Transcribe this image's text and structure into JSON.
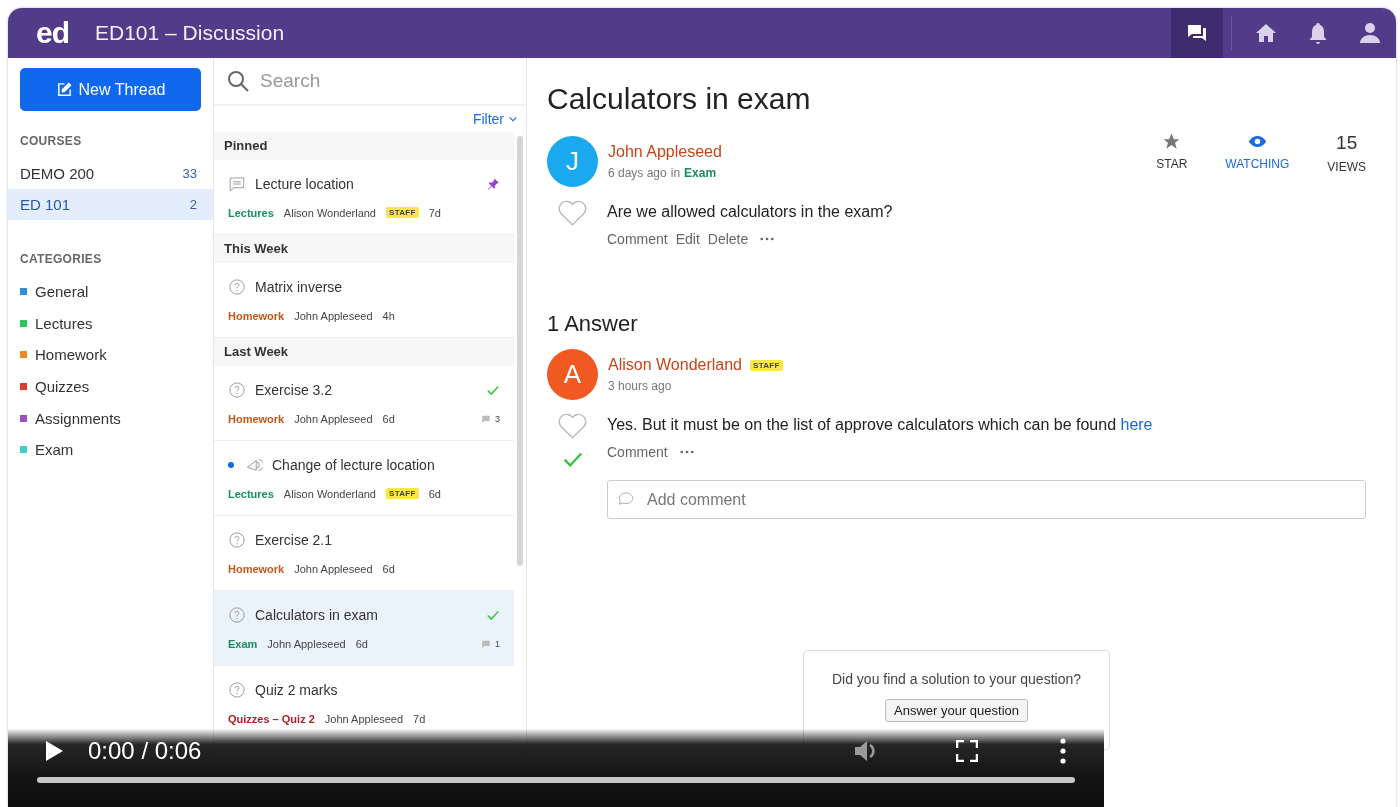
{
  "header": {
    "logo": "ed",
    "title": "ED101 – Discussion",
    "nav": [
      {
        "kind": "chat",
        "selected": true
      },
      {
        "kind": "home",
        "selected": false
      },
      {
        "kind": "bell",
        "selected": false
      },
      {
        "kind": "user",
        "selected": false
      }
    ]
  },
  "sidebar": {
    "new_thread_button": "New Thread",
    "courses_heading": "COURSES",
    "courses": [
      {
        "name": "DEMO 200",
        "count": "33",
        "selected": false
      },
      {
        "name": "ED 101",
        "count": "2",
        "selected": true
      }
    ],
    "categories_heading": "CATEGORIES",
    "categories": [
      {
        "name": "General",
        "color": "#2f8fd8"
      },
      {
        "name": "Lectures",
        "color": "#2ec45e"
      },
      {
        "name": "Homework",
        "color": "#f08a1c"
      },
      {
        "name": "Quizzes",
        "color": "#e03a2a"
      },
      {
        "name": "Assignments",
        "color": "#9b4fc0"
      },
      {
        "name": "Exam",
        "color": "#3fd0c0"
      }
    ]
  },
  "thread_list": {
    "search": {
      "placeholder": "Search"
    },
    "filter": "Filter",
    "groups": [
      {
        "heading": "Pinned",
        "threads": [
          {
            "kind": "post",
            "title": "Lecture location",
            "unread": false,
            "pinned": true,
            "answered": false,
            "selected": false,
            "category": "Lectures",
            "color": "#16905a",
            "author": "Alison Wonderland",
            "badge": "STAFF",
            "age": "7d"
          }
        ]
      },
      {
        "heading": "This Week",
        "threads": [
          {
            "kind": "question",
            "title": "Matrix inverse",
            "unread": false,
            "pinned": false,
            "answered": false,
            "selected": false,
            "category": "Homework",
            "color": "#c4571a",
            "author": "John Appleseed",
            "age": "4h"
          }
        ]
      },
      {
        "heading": "Last Week",
        "threads": [
          {
            "kind": "question",
            "title": "Exercise 3.2",
            "unread": false,
            "pinned": false,
            "answered": true,
            "selected": false,
            "category": "Homework",
            "color": "#c4571a",
            "author": "John Appleseed",
            "age": "6d",
            "comments": "3"
          },
          {
            "kind": "announcement",
            "title": "Change of lecture location",
            "unread": true,
            "pinned": false,
            "answered": false,
            "selected": false,
            "category": "Lectures",
            "color": "#16905a",
            "author": "Alison Wonderland",
            "badge": "STAFF",
            "age": "6d"
          },
          {
            "kind": "question",
            "title": "Exercise 2.1",
            "unread": false,
            "pinned": false,
            "answered": false,
            "selected": false,
            "category": "Homework",
            "color": "#c4571a",
            "author": "John Appleseed",
            "age": "6d"
          },
          {
            "kind": "question",
            "title": "Calculators in exam",
            "unread": false,
            "pinned": false,
            "answered": true,
            "selected": true,
            "category": "Exam",
            "color": "#16905a",
            "author": "John Appleseed",
            "age": "6d",
            "comments": "1"
          },
          {
            "kind": "question",
            "title": "Quiz 2 marks",
            "unread": false,
            "pinned": false,
            "answered": false,
            "selected": false,
            "category": "Quizzes – Quiz 2",
            "color": "#b0202a",
            "author": "John Appleseed",
            "age": "7d"
          }
        ]
      }
    ]
  },
  "thread": {
    "title": "Calculators in exam",
    "author": "John Appleseed",
    "avatar_letter": "J",
    "time": "6 days ago",
    "in": "in",
    "category": "Exam",
    "stats": [
      {
        "kind": "star",
        "label": "STAR",
        "selected": false
      },
      {
        "kind": "watch",
        "label": "WATCHING",
        "selected": true
      },
      {
        "kind": "count",
        "value": "15",
        "label": "VIEWS"
      }
    ],
    "body": "Are we allowed calculators in the exam?",
    "liked": false,
    "actions": [
      "Comment",
      "Edit",
      "Delete"
    ],
    "answers_heading": "1 Answer",
    "answers": [
      {
        "author": "Alison Wonderland",
        "badge": "STAFF",
        "avatar_letter": "A",
        "time": "3 hours ago",
        "body": "Yes. But it must be on the list of approve calculators which can be found",
        "link": "here",
        "liked": false,
        "accepted": true,
        "actions": [
          "Comment"
        ],
        "comment_placeholder": "Add comment"
      }
    ]
  },
  "prompt": {
    "text": "Did you find a solution to your question?",
    "button": "Answer your question"
  },
  "video": {
    "time": "0:00 / 0:06",
    "level": 0
  }
}
